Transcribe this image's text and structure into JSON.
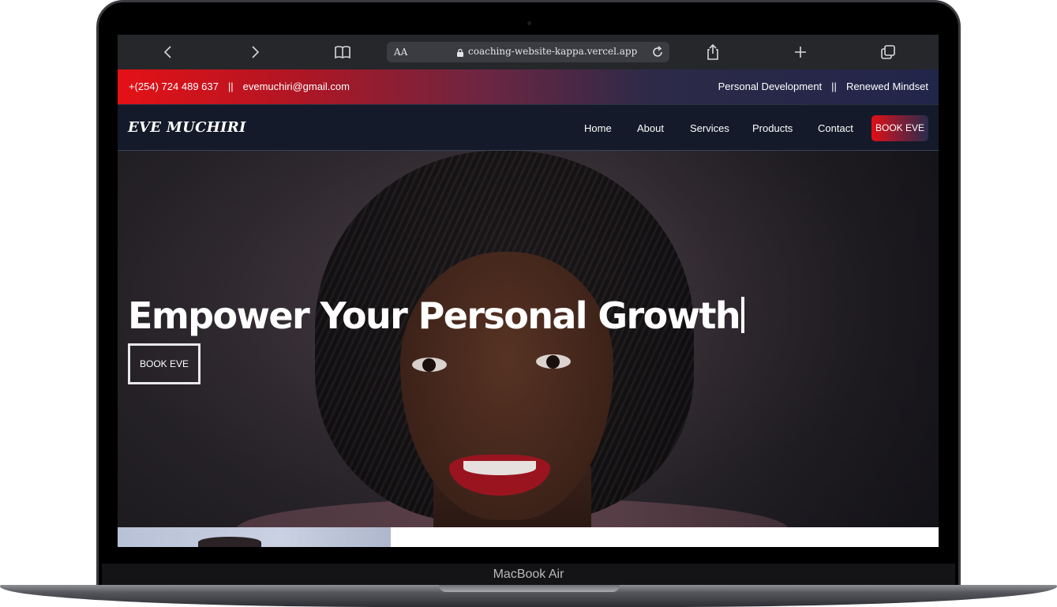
{
  "device": {
    "label": "MacBook Air"
  },
  "browser": {
    "text_size_label": "AA",
    "url": "coaching-website-kappa.vercel.app"
  },
  "topbar": {
    "phone": "+(254) 724 489 637",
    "separator": "||",
    "email": "evemuchiri@gmail.com",
    "tag1": "Personal Development",
    "tag2": "Renewed Mindset",
    "gradient_start": "#e41116",
    "gradient_end": "#22254a"
  },
  "nav": {
    "logo": "EVE MUCHIRI",
    "items": [
      "Home",
      "About",
      "Services",
      "Products",
      "Contact"
    ],
    "cta": "BOOK EVE",
    "background": "#141a29"
  },
  "hero": {
    "headline": "Empower Your Personal Growth",
    "cta": "BOOK EVE"
  },
  "icons": [
    "back-icon",
    "forward-icon",
    "bookmarks-icon",
    "lock-icon",
    "reload-icon",
    "share-icon",
    "new-tab-icon",
    "tabs-icon"
  ]
}
